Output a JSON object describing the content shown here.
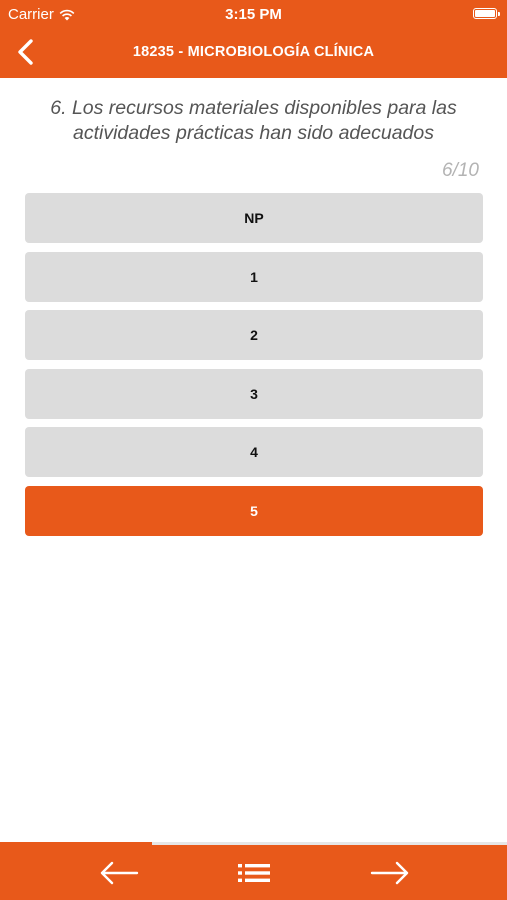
{
  "status_bar": {
    "carrier": "Carrier",
    "time": "3:15 PM"
  },
  "nav": {
    "title": "18235 - MICROBIOLOGÍA CLÍNICA"
  },
  "question": {
    "text": "6. Los recursos materiales disponibles para las actividades prácticas han sido adecuados",
    "progress_label": "6/10",
    "progress_fraction": 0.3
  },
  "options": [
    {
      "label": "NP",
      "selected": false
    },
    {
      "label": "1",
      "selected": false
    },
    {
      "label": "2",
      "selected": false
    },
    {
      "label": "3",
      "selected": false
    },
    {
      "label": "4",
      "selected": false
    },
    {
      "label": "5",
      "selected": true
    }
  ],
  "icons": {
    "back": "chevron-left-icon",
    "prev": "arrow-left-icon",
    "list": "list-icon",
    "next": "arrow-right-icon"
  },
  "colors": {
    "accent": "#e8591a",
    "option_bg": "#dcdcdc"
  }
}
